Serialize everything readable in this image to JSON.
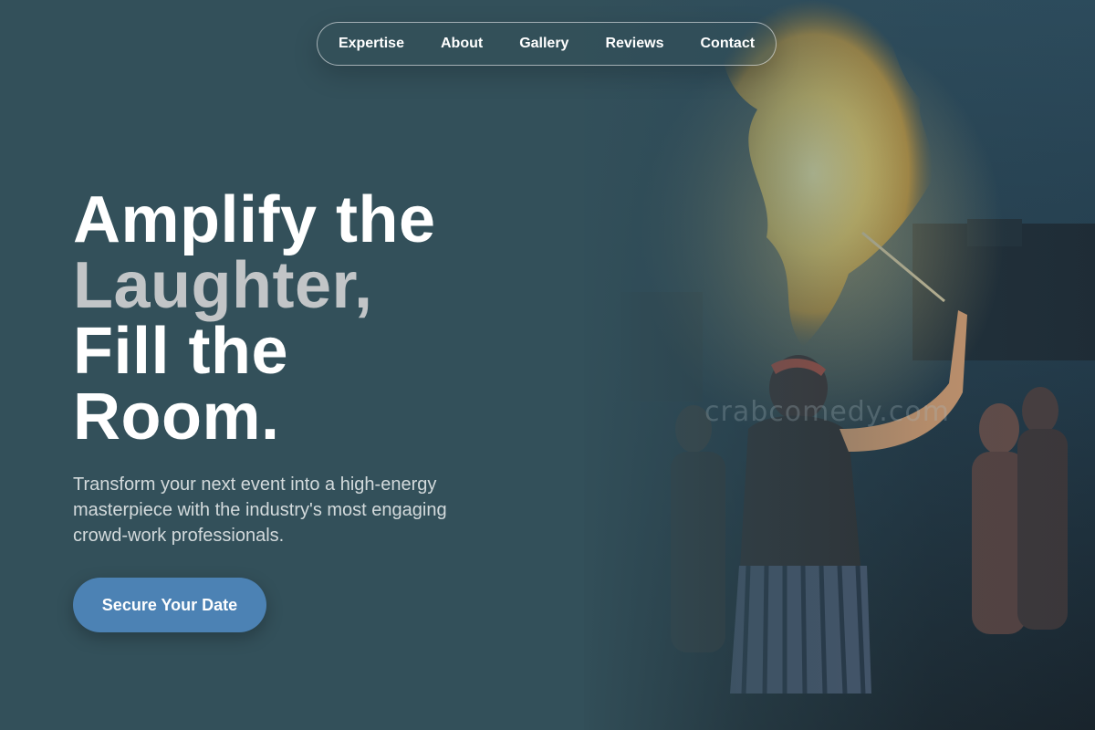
{
  "nav": {
    "items": [
      {
        "label": "Expertise"
      },
      {
        "label": "About"
      },
      {
        "label": "Gallery"
      },
      {
        "label": "Reviews"
      },
      {
        "label": "Contact"
      }
    ]
  },
  "hero": {
    "title_line1": "Amplify the",
    "title_line2": "Laughter,",
    "title_line3": "Fill the",
    "title_line4": "Room.",
    "subtitle": "Transform your next event into a high-energy masterpiece with the industry's most engaging crowd-work professionals.",
    "cta_label": "Secure Your Date"
  },
  "background": {
    "description_icon": "fire-breather-photo",
    "watermark": "crabcomedy.com"
  },
  "colors": {
    "background": "#33505a",
    "cta": "#4c82b4",
    "title": "#ffffff",
    "title_muted": "#c2c5c7",
    "subtitle": "#d3dadc"
  }
}
